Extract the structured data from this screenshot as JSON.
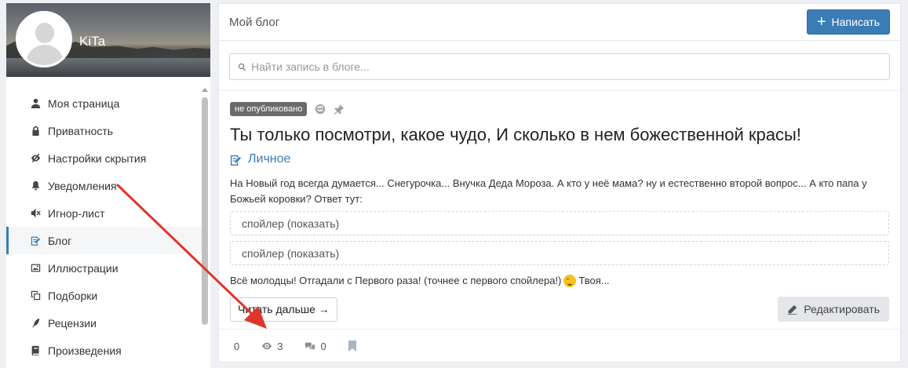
{
  "profile": {
    "name": "KiTa"
  },
  "sidebar": {
    "items": [
      {
        "label": "Моя страница",
        "icon": "user-icon"
      },
      {
        "label": "Приватность",
        "icon": "lock-icon"
      },
      {
        "label": "Настройки скрытия",
        "icon": "eye-slash-icon"
      },
      {
        "label": "Уведомления",
        "icon": "bell-icon"
      },
      {
        "label": "Игнор-лист",
        "icon": "mute-icon"
      },
      {
        "label": "Блог",
        "icon": "blog-edit-icon",
        "active": true
      },
      {
        "label": "Иллюстрации",
        "icon": "picture-icon"
      },
      {
        "label": "Подборки",
        "icon": "collections-icon"
      },
      {
        "label": "Рецензии",
        "icon": "quill-icon"
      },
      {
        "label": "Произведения",
        "icon": "book-icon"
      }
    ]
  },
  "header": {
    "title": "Мой блог",
    "write_label": "Написать"
  },
  "search": {
    "placeholder": "Найти запись в блоге..."
  },
  "post": {
    "status_badge": "не опубликовано",
    "title": "Ты только посмотри, какое чудо, И сколько в нем божественной красы!",
    "category": "Личное",
    "text": "На Новый год всегда думается... Снегурочка... Внучка Деда Мороза. А кто у неё мама? ну и естественно второй вопрос... А кто папа у Божьей коровки? Ответ тут:",
    "spoilers": [
      "спойлер (показать)",
      "спойлер (показать)"
    ],
    "text2_before": "Всё молодцы! Отгадали с Первого раза! (точнее с первого спойлера!)",
    "text2_after": "Твоя...",
    "read_more": "Читать дальше →",
    "edit_label": "Редактировать"
  },
  "stats": {
    "likes": "0",
    "views": "3",
    "comments": "0"
  },
  "colors": {
    "accent": "#3a7db5",
    "annotation_arrow": "#e0352b"
  }
}
